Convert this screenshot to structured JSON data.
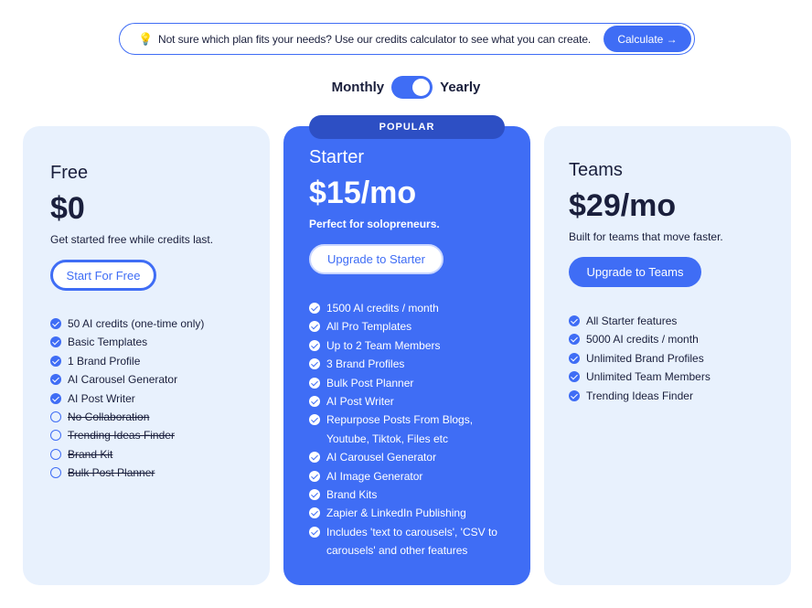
{
  "banner": {
    "icon": "lightbulb-icon",
    "message": "Not sure which plan fits your needs? Use our credits calculator to see what you can create.",
    "button": "Calculate →"
  },
  "billing": {
    "monthly": "Monthly",
    "yearly": "Yearly",
    "selected": "Yearly"
  },
  "plans": {
    "free": {
      "name": "Free",
      "price": "$0",
      "tagline": "Get started free while credits last.",
      "button": "Start For Free",
      "features": [
        {
          "text": "50 AI credits (one-time only)",
          "included": true
        },
        {
          "text": "Basic Templates",
          "included": true
        },
        {
          "text": "1 Brand Profile",
          "included": true
        },
        {
          "text": "AI Carousel Generator",
          "included": true
        },
        {
          "text": "AI Post Writer",
          "included": true
        },
        {
          "text": "No Collaboration",
          "included": false
        },
        {
          "text": "Trending Ideas Finder",
          "included": false
        },
        {
          "text": "Brand Kit",
          "included": false
        },
        {
          "text": "Bulk Post Planner",
          "included": false
        }
      ]
    },
    "starter": {
      "badge": "POPULAR",
      "name": "Starter",
      "price": "$15/mo",
      "tagline": "Perfect for solopreneurs.",
      "button": "Upgrade to Starter",
      "features": [
        "1500 AI credits / month",
        "All Pro Templates",
        "Up to 2 Team Members",
        "3 Brand Profiles",
        "Bulk Post Planner",
        "AI Post Writer",
        "Repurpose Posts From Blogs, Youtube, Tiktok, Files etc",
        "AI Carousel Generator",
        "AI Image Generator",
        "Brand Kits",
        "Zapier & LinkedIn Publishing",
        "Includes 'text to carousels', 'CSV to carousels' and other features"
      ]
    },
    "teams": {
      "name": "Teams",
      "price": "$29/mo",
      "tagline": "Built for teams that move faster.",
      "button": "Upgrade to Teams",
      "features": [
        "All Starter features",
        "5000 AI credits / month",
        "Unlimited Brand Profiles",
        "Unlimited Team Members",
        "Trending Ideas Finder"
      ]
    }
  },
  "colors": {
    "accent": "#3f6df5",
    "card_bg": "#e8f1fd",
    "badge_bg": "#2d4fc4",
    "text": "#1a1f3c"
  }
}
